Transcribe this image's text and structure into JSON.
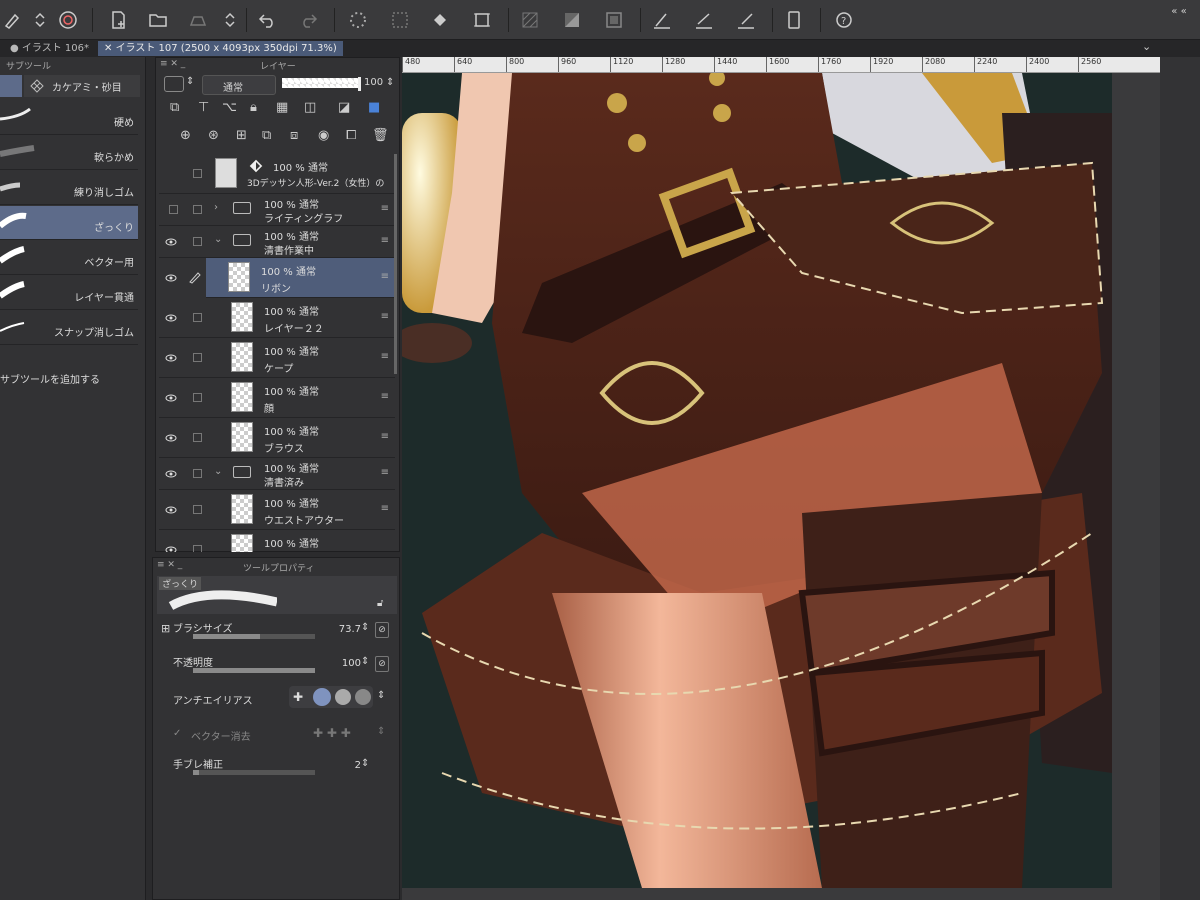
{
  "tabs": [
    {
      "label": "イラスト 106*"
    },
    {
      "label": "イラスト 107 (2500 x 4093px 350dpi 71.3%)"
    }
  ],
  "subtool": {
    "title": "サブツール",
    "category": "カケアミ・砂目",
    "items": [
      {
        "label": "硬め"
      },
      {
        "label": "軟らかめ"
      },
      {
        "label": "練り消しゴム"
      },
      {
        "label": "ざっくり"
      },
      {
        "label": "ベクター用"
      },
      {
        "label": "レイヤー貫通"
      },
      {
        "label": "スナップ消しゴム"
      }
    ],
    "add_label": "サブツールを追加する"
  },
  "layer_panel": {
    "title": "レイヤー",
    "blend_mode": "通常",
    "opacity": "100",
    "layers": [
      {
        "opacity_mode": "100 % 通常",
        "name": "3Dデッサン人形-Ver.2（女性）の"
      },
      {
        "opacity_mode": "100 % 通常",
        "name": "ライティングラフ"
      },
      {
        "opacity_mode": "100 % 通常",
        "name": "清書作業中"
      },
      {
        "opacity_mode": "100 % 通常",
        "name": "リボン"
      },
      {
        "opacity_mode": "100 % 通常",
        "name": "レイヤー２２"
      },
      {
        "opacity_mode": "100 % 通常",
        "name": "ケープ"
      },
      {
        "opacity_mode": "100 % 通常",
        "name": "顔"
      },
      {
        "opacity_mode": "100 % 通常",
        "name": "ブラウス"
      },
      {
        "opacity_mode": "100 % 通常",
        "name": "清書済み"
      },
      {
        "opacity_mode": "100 % 通常",
        "name": "ウエストアウター"
      },
      {
        "opacity_mode": "100 % 通常",
        "name": ""
      }
    ]
  },
  "tool_property": {
    "title": "ツールプロパティ",
    "preset": "ざっくり",
    "brush_size_label": "ブラシサイズ",
    "brush_size": "73.7",
    "brush_size_fill": 0.55,
    "opacity_label": "不透明度",
    "opacity": "100",
    "opacity_fill": 1.0,
    "antialias_label": "アンチエイリアス",
    "vector_erase_label": "ベクター消去",
    "stabilization_label": "手ブレ補正",
    "stabilization": "2",
    "stabilization_fill": 0.05
  },
  "ruler": [
    "480",
    "640",
    "800",
    "960",
    "1120",
    "1280",
    "1440",
    "1600",
    "1760",
    "1920",
    "2080",
    "2240",
    "2400",
    "2560"
  ],
  "colors": {
    "selection": "#5d6b8a",
    "panel": "#323234"
  }
}
